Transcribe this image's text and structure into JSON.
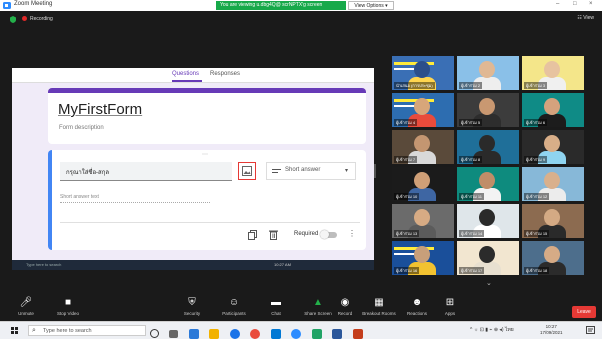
{
  "window": {
    "title": "Zoom Meeting",
    "controls": [
      "–",
      "□",
      "×"
    ]
  },
  "share_banner": {
    "text": "You are viewing u.dbg4Q@ scrNPTX'g screen",
    "view_options": "View Options ▾"
  },
  "meeting": {
    "recording": "Recording",
    "view": "☷ View"
  },
  "form": {
    "tabs": {
      "questions": "Questions",
      "responses": "Responses"
    },
    "title": "MyFirstForm",
    "description": "Form description",
    "question_text": "กรุณาใส่ชื่อ-สกุล",
    "question_type": "Short answer",
    "short_answer_text": "Short answer text",
    "required_label": "Required"
  },
  "remote_taskbar": {
    "search": "Type here to search",
    "time": "10:27 AM"
  },
  "gallery": {
    "participants": [
      {
        "name": "นำเสนอ (การประชุม)",
        "bg": "#3a6fb5",
        "skin": "#2c4f8a",
        "shirt": "#ffd54f",
        "slide": true
      },
      {
        "name": "ผู้เข้าร่วม 2",
        "bg": "#8ac0e8",
        "skin": "#e0b894",
        "shirt": "#eeeeee"
      },
      {
        "name": "ผู้เข้าร่วม 3",
        "bg": "#f4e68a",
        "skin": "#e7c3a0",
        "shirt": "#f0f0f0"
      },
      {
        "name": "ผู้เข้าร่วม 4",
        "bg": "#2d6db0",
        "skin": "#d7a67a",
        "shirt": "#e94b3c",
        "slide": true
      },
      {
        "name": "ผู้เข้าร่วม 5",
        "bg": "#3c3c3c",
        "skin": "#c99871",
        "shirt": "#2d2d2d"
      },
      {
        "name": "ผู้เข้าร่วม 6",
        "bg": "#0f8b86",
        "skin": "#d4a27d",
        "shirt": "#1c1c1c"
      },
      {
        "name": "ผู้เข้าร่วม 7",
        "bg": "#5a4a3a",
        "skin": "#c49671",
        "shirt": "#d9d9d9"
      },
      {
        "name": "ผู้เข้าร่วม 8",
        "bg": "#1f6f99",
        "skin": "#2a2a2a",
        "shirt": "#2a2a2a"
      },
      {
        "name": "ผู้เข้าร่วม 9",
        "bg": "#2a2a2a",
        "skin": "#d8ae88",
        "shirt": "#8fd4f0"
      },
      {
        "name": "ผู้เข้าร่วม 10",
        "bg": "#1b1b1b",
        "skin": "#cf9f77",
        "shirt": "#3e66a3"
      },
      {
        "name": "ผู้เข้าร่วม 11",
        "bg": "#0e8b7e",
        "skin": "#c08d68",
        "shirt": "#f3f3f3"
      },
      {
        "name": "ผู้เข้าร่วม 12",
        "bg": "#87b8d8",
        "skin": "#d9b08c",
        "shirt": "#ececec"
      },
      {
        "name": "ผู้เข้าร่วม 13",
        "bg": "#6b6b6b",
        "skin": "#d7ab84",
        "shirt": "#5b5b5b"
      },
      {
        "name": "ผู้เข้าร่วม 14",
        "bg": "#dfe6ea",
        "skin": "#2a2a2a",
        "shirt": "#ffffff"
      },
      {
        "name": "ผู้เข้าร่วม 15",
        "bg": "#8c6b50",
        "skin": "#d4aa84",
        "shirt": "#2a2a2a"
      },
      {
        "name": "ผู้เข้าร่วม 16",
        "bg": "#1a4f9a",
        "skin": "#c89f7a",
        "shirt": "#f2c230",
        "slide": true
      },
      {
        "name": "ผู้เข้าร่วม 17",
        "bg": "#f2e6d0",
        "skin": "#2b2b2b",
        "shirt": "#e8e0d0"
      },
      {
        "name": "ผู้เข้าร่วม 18",
        "bg": "#4d6e8c",
        "skin": "#d6ab86",
        "shirt": "#2b2b2b"
      }
    ]
  },
  "controls": {
    "items": [
      {
        "label": "Unmute",
        "icon": "🎤︎"
      },
      {
        "label": "Stop Video",
        "icon": "■"
      },
      {
        "label": "Security",
        "icon": "⛨"
      },
      {
        "label": "Participants",
        "icon": "☺"
      },
      {
        "label": "Chat",
        "icon": "▬"
      },
      {
        "label": "Share Screen",
        "icon": "▲"
      },
      {
        "label": "Record",
        "icon": "◉"
      },
      {
        "label": "Breakout Rooms",
        "icon": "▦"
      },
      {
        "label": "Reactions",
        "icon": "☻"
      },
      {
        "label": "Apps",
        "icon": "⊞"
      }
    ],
    "leave": "Leave"
  },
  "local_taskbar": {
    "search": "Type here to search",
    "time": "10:27",
    "date": "17/09/2021",
    "tray": "^ ☼ ⊡ ▮ ⌁ ⊕ ◂) ไทย"
  }
}
